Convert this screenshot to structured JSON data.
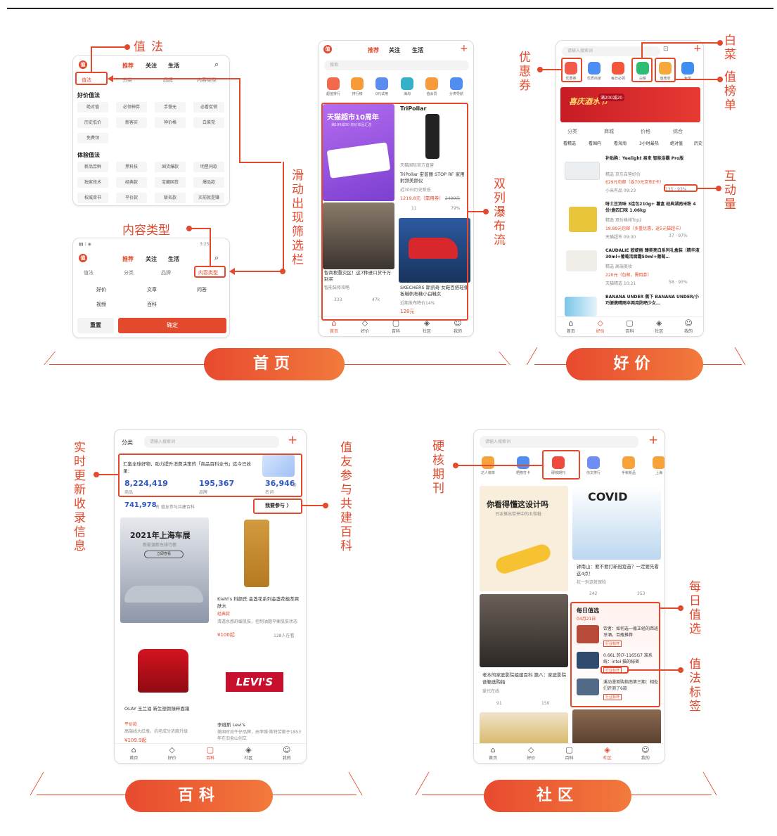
{
  "home": {
    "section_title": "首页",
    "annotations": {
      "zhifa": "值法",
      "content_type": "内容类型",
      "scroll_filter": "滑动出现筛选栏",
      "double_feed": "双列瀑布流"
    },
    "tabs": [
      "推荐",
      "关注",
      "生活"
    ],
    "filter_bar": [
      "值法",
      "分类",
      "品牌",
      "内容类型"
    ],
    "price_section": "好价值法",
    "price_items": [
      "绝对值",
      "必领神券",
      "手慢无",
      "必看促销",
      "历史低价",
      "新客买",
      "神价格",
      "白菜党",
      "免费领"
    ],
    "exp_section": "体验值法",
    "exp_items": [
      "新品尝鲜",
      "黑科技",
      "国货爆款",
      "明星同款",
      "独家技术",
      "经典款",
      "宝藏国货",
      "爆品款",
      "权威背书",
      "平价款",
      "联名款",
      "买前就是赚"
    ],
    "statusbar": "3:25",
    "filter_tabs": [
      "值法",
      "分类",
      "品牌",
      "内容类型"
    ],
    "content_types": [
      "好价",
      "文章",
      "问答",
      "视频",
      "百科"
    ],
    "reset_label": "重置",
    "confirm_label": "确定",
    "search_placeholder": "搜索",
    "categories": [
      "超值排行",
      "排行榜",
      "0元试用",
      "海淘",
      "值会员",
      "分类导航"
    ],
    "card1_title": "天猫超市10周年",
    "card1_sub": "满199减30 好价单品汇总",
    "card2_brand": "TriPollar",
    "card2_shop": "天猫国际官方直营",
    "card2_title": "TriPollar 宙普丽 STOP RF 家用射频美颜仪",
    "card2_meta": "近30日历史新低",
    "card2_price": "1219.8元（需用券）",
    "card2_old": "2499元",
    "card2_comments": "11",
    "card2_likes": "79%",
    "card3_title": "智商税重灾区！这7种进口货千万别买",
    "card3_author": "智能装修攻略",
    "card3_comments": "333",
    "card3_likes": "47k",
    "card4_title": "SKECHERS 斯凯奇 女鞋百搭轻便板鞋帆布鞋小白鞋女",
    "card4_meta": "近期发布降价14%",
    "card4_price": "128元",
    "nav": [
      "首页",
      "好价",
      "百科",
      "社区",
      "我的"
    ]
  },
  "deals": {
    "section_title": "好价",
    "annotations": {
      "coupon": "优惠券",
      "cabbage": "白菜",
      "ranking": "值榜单",
      "interaction": "互动量"
    },
    "search_placeholder": "请输入搜索词",
    "categories": [
      "优惠券",
      "优质商家",
      "每日必领",
      "白菜",
      "值榜单",
      "免单"
    ],
    "banner_text": "喜庆酒水节",
    "banner_badge": "满200减20",
    "filters": [
      "分类",
      "商城",
      "价格",
      "综合"
    ],
    "filter_tabs": [
      "看精选",
      "看国内",
      "看海淘",
      "3小时最热",
      "绝对值",
      "历史"
    ],
    "items": [
      {
        "title": "补贴购：Yeelight 易来 智能浴霸 Pro版",
        "meta": "精选 京东自营好价",
        "price": "629元包邮（返70元京东E卡）",
        "time": "小米有品 09:23",
        "stats": "135 · 93%"
      },
      {
        "title": "呀土豆双味 3连包210g+ 薯盒 经典湖南米粉 4份/盒四口味 1.06kg",
        "meta": "精选 双价格排Top2",
        "price": "18.89元包邮（多重优惠，返5元猫超卡）",
        "time": "天猫超市 09:00",
        "stats": "37 · 97%"
      },
      {
        "title": "CAUDALIE 欧缇丽 臻美亮白系列礼盒装（精华液30ml+葡萄活面霜50ml+葡萄…",
        "meta": "精选 高端美妆",
        "price": "220元（包邮，需用券）",
        "time": "天猫精选 10:21",
        "stats": "58 · 93%"
      },
      {
        "title": "BANANA UNDER 蕉下 BANANA UNDER/小巧便携晴雨伞两用防晒少女…",
        "meta": "",
        "price": "",
        "time": "",
        "stats": ""
      }
    ],
    "nav": [
      "首页",
      "好价",
      "百科",
      "社区",
      "我的"
    ]
  },
  "wiki": {
    "section_title": "百科",
    "annotations": {
      "realtime": "实时更新收录信息",
      "co_build": "值友参与共建百科"
    },
    "category_label": "分类",
    "search_placeholder": "请输入搜索词",
    "info_text": "汇集全球好物，助力提升消费决策的「商品百科全书」迄今已收录：",
    "stats": [
      {
        "value": "8,224,419",
        "unit": "件",
        "label": "商品"
      },
      {
        "value": "195,367",
        "unit": "个",
        "label": "品牌"
      },
      {
        "value": "36,946",
        "unit": "条",
        "label": "名词"
      }
    ],
    "participants": "741,978",
    "participants_label": "名 值友参与共建百科",
    "join_label": "我要参与 〉",
    "card1_title": "2021年上海车展",
    "card1_sub": "新能源新车排行榜",
    "card1_btn": "立即查看",
    "card2_title": "Kiehl's 科颜氏 金盏花系列金盏花植萃爽肤水",
    "card2_tag": "经典款",
    "card2_desc": "清透水感舒缓肌肤，控制油脂平衡肌肤状态",
    "card2_price": "¥100起",
    "card2_count": "128人在看",
    "card3_title": "OLAY 玉兰油 新生塑颜臻粹面霜",
    "card3_tag": "平价款",
    "card3_desc": "高端线大红瓶，抗老成分浓度升级",
    "card3_price": "¥109.9起",
    "card4_brand": "LEVI'S",
    "card4_title": "李维斯 Levi's",
    "card4_desc": "美国时尚牛仔品牌，由李维·斯特劳斯于1853年在旧金山创立",
    "nav": [
      "首页",
      "好价",
      "百科",
      "社区",
      "我的"
    ]
  },
  "community": {
    "section_title": "社区",
    "annotations": {
      "journal": "硬核期刊",
      "daily": "每日值选",
      "tag": "值法标签"
    },
    "search_placeholder": "请输入搜索词",
    "categories": [
      "达人榜单",
      "晒物打卡",
      "硬核期刊",
      "伤文排行",
      "手帐新品",
      "上海"
    ],
    "card1_title": "你看得懂这设计吗",
    "card1_sub": "日本推出带来中的五指鞋",
    "card2_brand": "COVID",
    "card2_title": "钟南山：要不要打新冠疫苗？一定要先看这4点！",
    "card2_author": "抗一刹这就保险",
    "card2_comments": "242",
    "card2_likes": "353",
    "card3_title": "老本的家庭影院组建百科 篇八：家庭影院音箱选购指",
    "card3_author": "爱代在线",
    "card3_comments": "91",
    "card3_likes": "150",
    "daily_title": "每日值选",
    "daily_date": "04月21日",
    "daily_items": [
      {
        "title": "饮者：如何选一瓶正经的西班牙酒，百瓶推荐",
        "tag": "行业标杆"
      },
      {
        "title": "0.66L 的i7-1165G7 准系统：intel 猫的秘密",
        "tag": "行业标杆"
      },
      {
        "title": "溪动漫首购指南第三期：相处们评测了6款",
        "tag": "行业标杆"
      }
    ],
    "nav": [
      "首页",
      "好价",
      "百科",
      "社区",
      "我的"
    ]
  }
}
